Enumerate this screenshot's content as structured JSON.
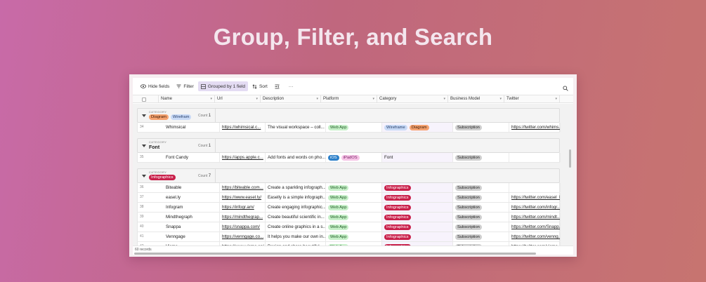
{
  "headline": "Group, Filter, and Search",
  "toolbar": {
    "hide_fields": "Hide fields",
    "filter": "Filter",
    "grouped": "Grouped by 1 field",
    "sort": "Sort",
    "more": "···"
  },
  "columns": {
    "name": "Name",
    "url": "Url",
    "description": "Description",
    "platform": "Platform",
    "category": "Category",
    "business_model": "Business Model",
    "twitter": "Twitter"
  },
  "group_label": "CATEGORY",
  "count_label": "Count",
  "groups": [
    {
      "values": [
        "Diagram",
        "Wirefram"
      ],
      "count": "1",
      "rows": [
        {
          "num": "34",
          "name": "Whimsical",
          "url": "https://whimsical.c...",
          "description": "The visual workspace – coll...",
          "platform": [
            "Web App"
          ],
          "category": [
            "Wireframe",
            "Diagram"
          ],
          "business": "Subscription",
          "twitter": "https://twitter.com/whims..."
        }
      ]
    },
    {
      "values": [
        "Font"
      ],
      "count": "1",
      "rows": [
        {
          "num": "35",
          "name": "Font Candy",
          "url": "https://apps.apple.c...",
          "description": "Add fonts and words on pho...",
          "platform": [
            "iOS",
            "iPadOS"
          ],
          "category": [
            "Font"
          ],
          "business": "Subscription",
          "twitter": ""
        }
      ]
    },
    {
      "values": [
        "Infographics"
      ],
      "count": "7",
      "rows": [
        {
          "num": "36",
          "name": "Biteable",
          "url": "https://biteable.com...",
          "description": "Create a sparkling infograph...",
          "platform": [
            "Web App"
          ],
          "category": [
            "Infographics"
          ],
          "business": "Subscription",
          "twitter": ""
        },
        {
          "num": "37",
          "name": "easel.ly",
          "url": "https://www.easel.ly/",
          "description": "Easelly is a simple infograph...",
          "platform": [
            "Web App"
          ],
          "category": [
            "Infographics"
          ],
          "business": "Subscription",
          "twitter": "https://twitter.com/easel_ly"
        },
        {
          "num": "38",
          "name": "Infogram",
          "url": "https://infogr.am/",
          "description": "Create engaging infographic...",
          "platform": [
            "Web App"
          ],
          "category": [
            "Infographics"
          ],
          "business": "Subscription",
          "twitter": "https://twitter.com/infogr..."
        },
        {
          "num": "39",
          "name": "Mindthegraph",
          "url": "https://mindthegrap...",
          "description": "Create beautiful scientific in...",
          "platform": [
            "Web App"
          ],
          "category": [
            "Infographics"
          ],
          "business": "Subscription",
          "twitter": "https://twitter.com/mindt..."
        },
        {
          "num": "40",
          "name": "Snappa",
          "url": "https://snappa.com/",
          "description": "Create online graphics in a s...",
          "platform": [
            "Web App"
          ],
          "category": [
            "Infographics"
          ],
          "business": "Subscription",
          "twitter": "https://twitter.com/Snapp..."
        },
        {
          "num": "41",
          "name": "Venngage",
          "url": "https://venngage.co...",
          "description": "It helps you make our own in...",
          "platform": [
            "Web App"
          ],
          "category": [
            "Infographics"
          ],
          "business": "Subscription",
          "twitter": "https://twitter.com/venng..."
        },
        {
          "num": "42",
          "name": "Visme",
          "url": "https://www.visme.co/",
          "description": "Design and share beautiful...",
          "platform": [
            "Web App"
          ],
          "category": [
            "Infographics"
          ],
          "business": "Subscription",
          "twitter": "https://twitter.com/visme..."
        }
      ]
    }
  ],
  "footer": {
    "records": "60 records"
  }
}
